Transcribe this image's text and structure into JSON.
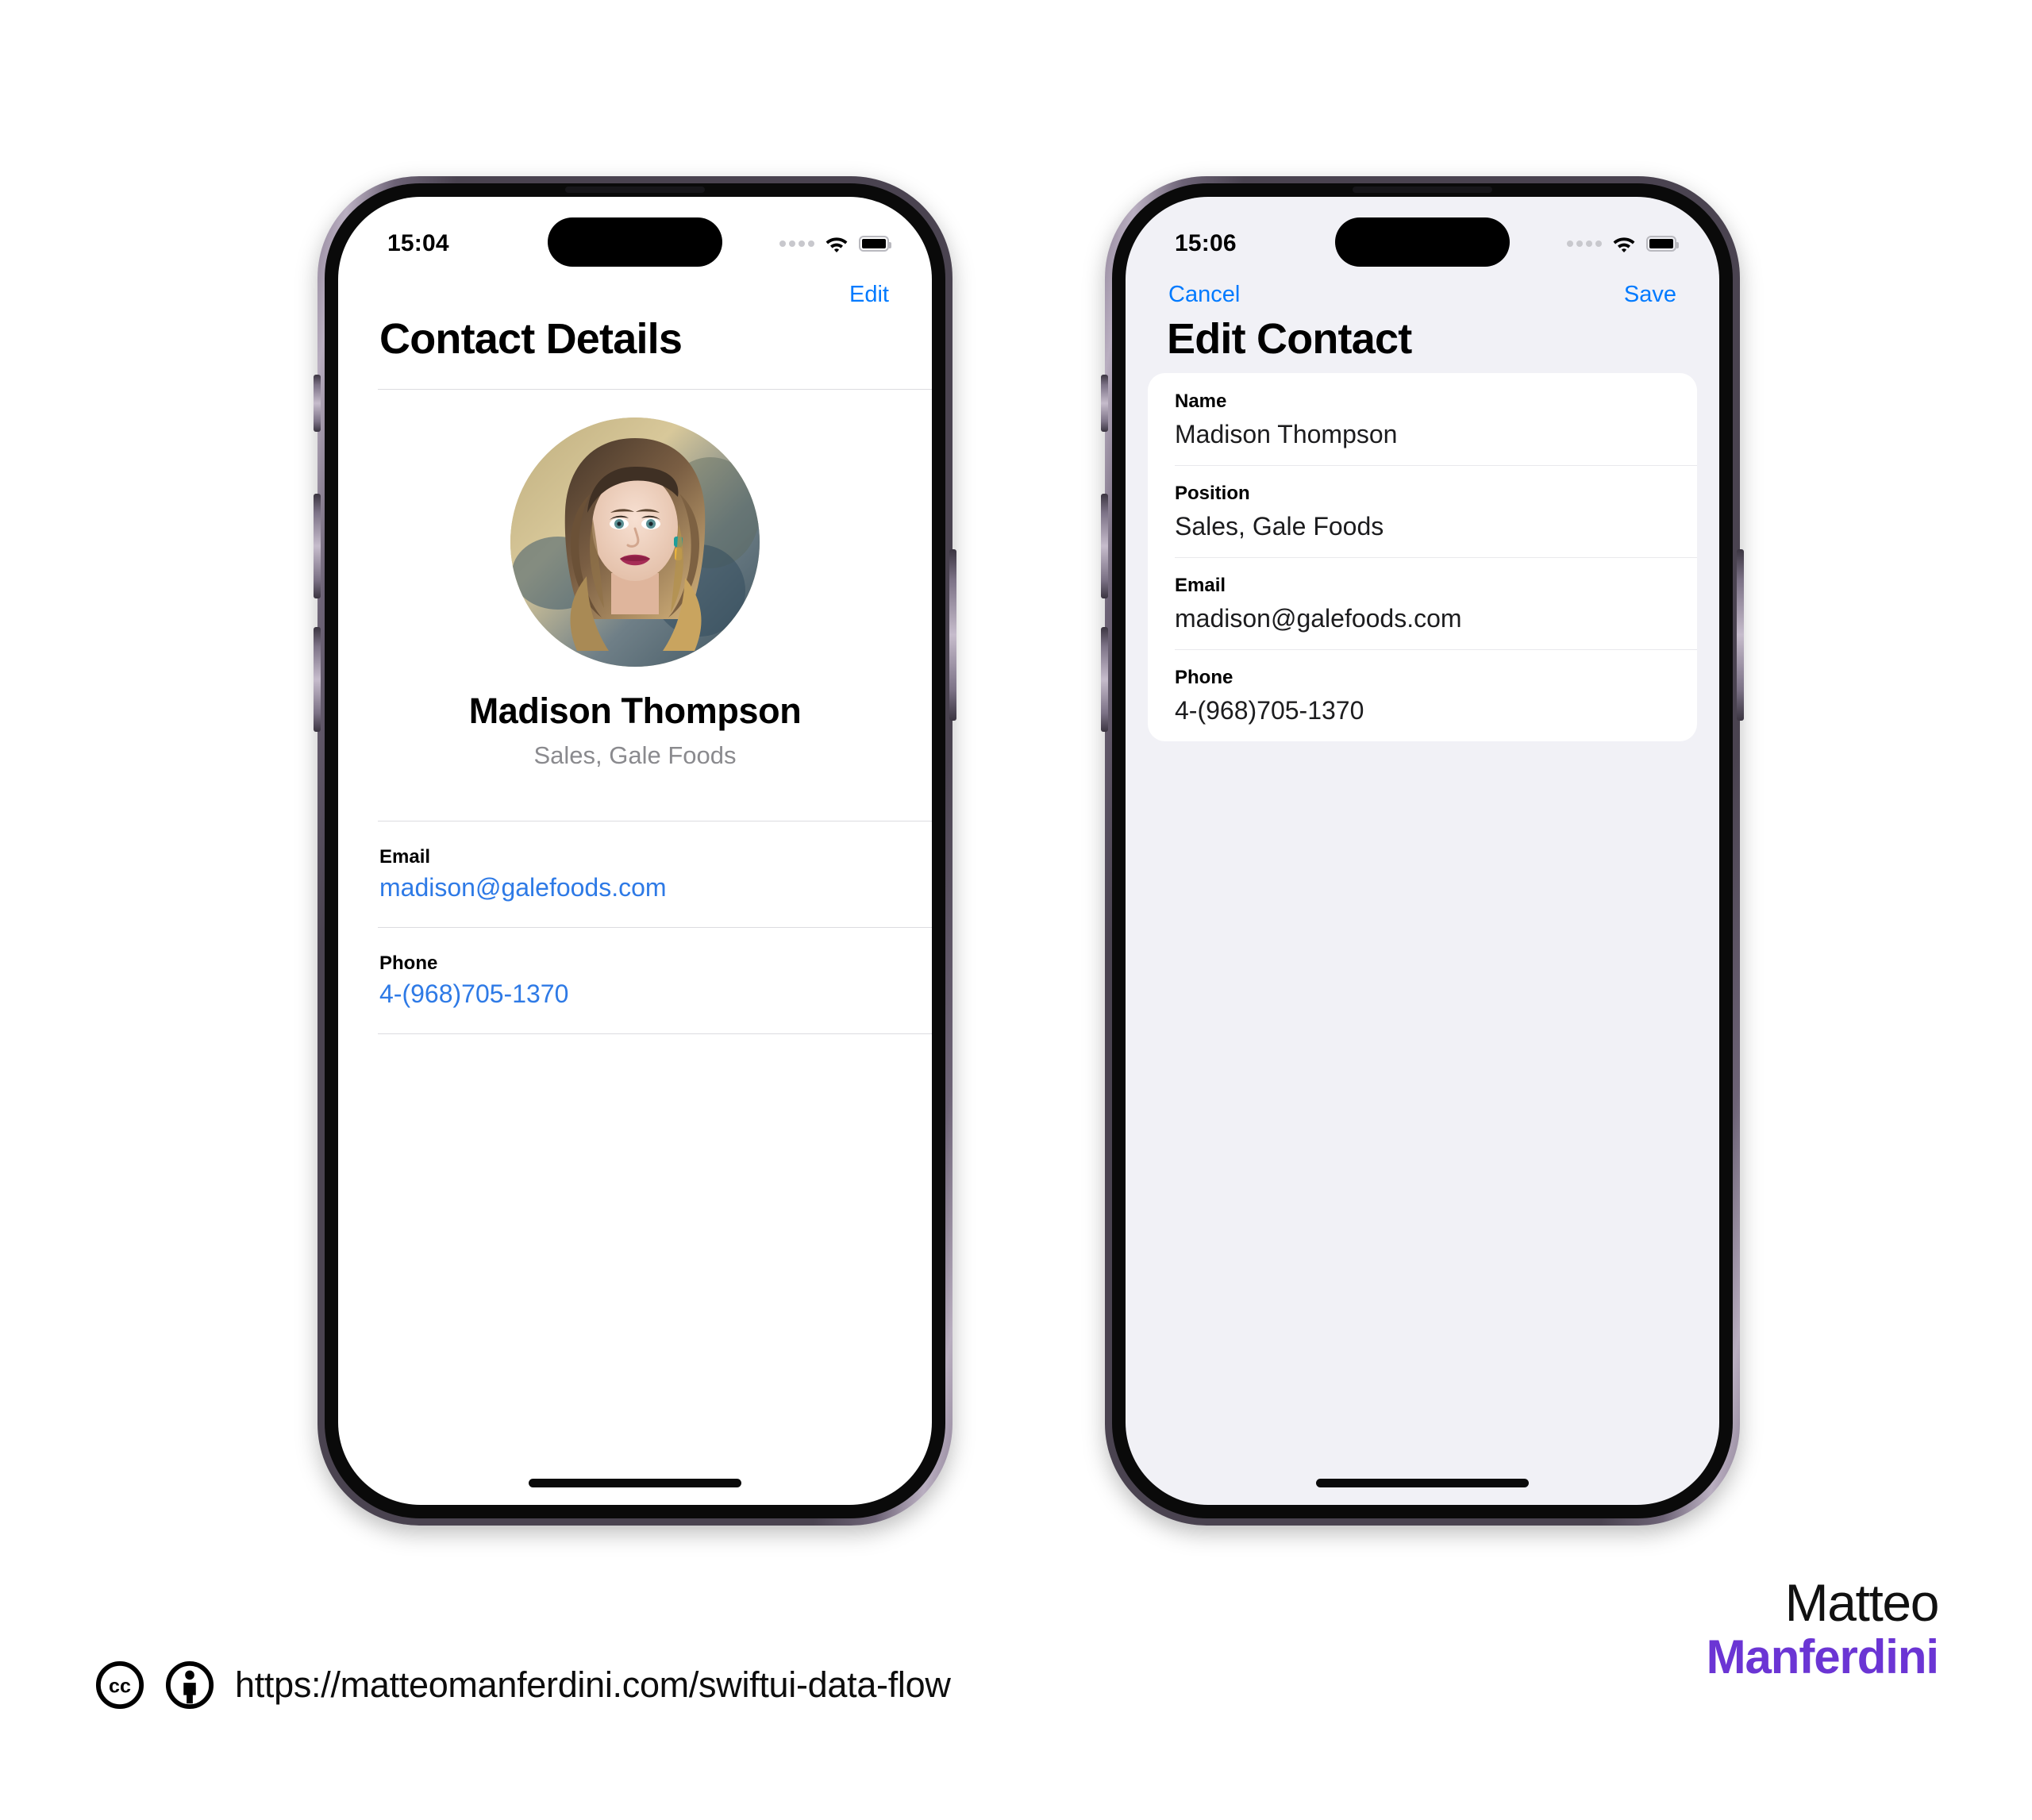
{
  "phones": [
    {
      "id": "contact-details",
      "status_bar": {
        "time": "15:04",
        "cellular_icon": "cellular-dots-icon",
        "wifi_icon": "wifi-icon",
        "battery_icon": "battery-icon"
      },
      "nav": {
        "right_button": "Edit"
      },
      "title": "Contact Details",
      "avatar": {
        "icon": "contact-avatar-photo",
        "alt": "Madison Thompson portrait"
      },
      "contact": {
        "name": "Madison Thompson",
        "role": "Sales, Gale Foods"
      },
      "fields": [
        {
          "label": "Email",
          "value": "madison@galefoods.com",
          "link": true
        },
        {
          "label": "Phone",
          "value": "4-(968)705-1370",
          "link": true
        }
      ]
    },
    {
      "id": "edit-contact",
      "status_bar": {
        "time": "15:06",
        "cellular_icon": "cellular-dots-icon",
        "wifi_icon": "wifi-icon",
        "battery_icon": "battery-icon"
      },
      "nav": {
        "left_button": "Cancel",
        "right_button": "Save"
      },
      "title": "Edit Contact",
      "form": [
        {
          "label": "Name",
          "value": "Madison Thompson"
        },
        {
          "label": "Position",
          "value": "Sales, Gale Foods"
        },
        {
          "label": "Email",
          "value": "madison@galefoods.com"
        },
        {
          "label": "Phone",
          "value": "4-(968)705-1370"
        }
      ]
    }
  ],
  "footer": {
    "cc_icon": "creative-commons-icon",
    "by_icon": "creative-commons-attribution-icon",
    "url": "https://matteomanferdini.com/swiftui-data-flow",
    "brand_line1": "Matteo",
    "brand_line2": "Manferdini"
  },
  "colors": {
    "accent_blue": "#007aff",
    "link_blue": "#2e7ae6",
    "brand_purple": "#6b35d4",
    "grouped_background": "#f1f1f6",
    "secondary_text": "#8a8a8e"
  }
}
